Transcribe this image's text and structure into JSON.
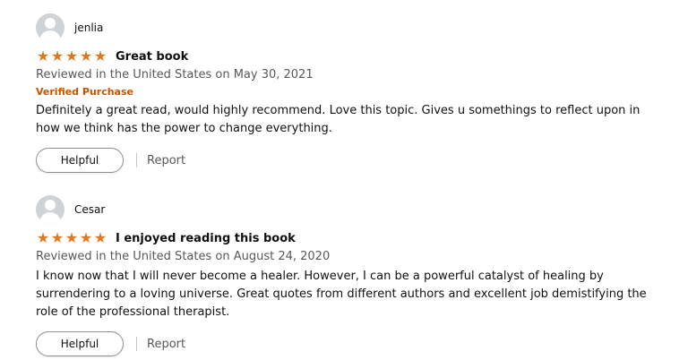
{
  "reviews": [
    {
      "author": "jenlia",
      "rating": 5,
      "title": "Great book",
      "date": "Reviewed in the United States on May 30, 2021",
      "verified": "Verified Purchase",
      "body": "Definitely a great read, would highly recommend. Love this topic. Gives u somethings to reflect upon in how we think has the power to change everything.",
      "helpful_label": "Helpful",
      "report_label": "Report"
    },
    {
      "author": "Cesar",
      "rating": 5,
      "title": "I enjoyed reading this book",
      "date": "Reviewed in the United States on August 24, 2020",
      "body": "I know now that I will never become a healer. However, I can be a powerful catalyst of healing by surrendering to a loving universe. Great quotes from different authors and excellent job demistifying the role of the professional therapist.",
      "helpful_label": "Helpful",
      "report_label": "Report"
    }
  ],
  "colors": {
    "star": "#de7921",
    "verified": "#c45500",
    "secondary_text": "#565959"
  },
  "icons": {
    "avatar": "default-avatar-icon",
    "star": "star-icon"
  }
}
